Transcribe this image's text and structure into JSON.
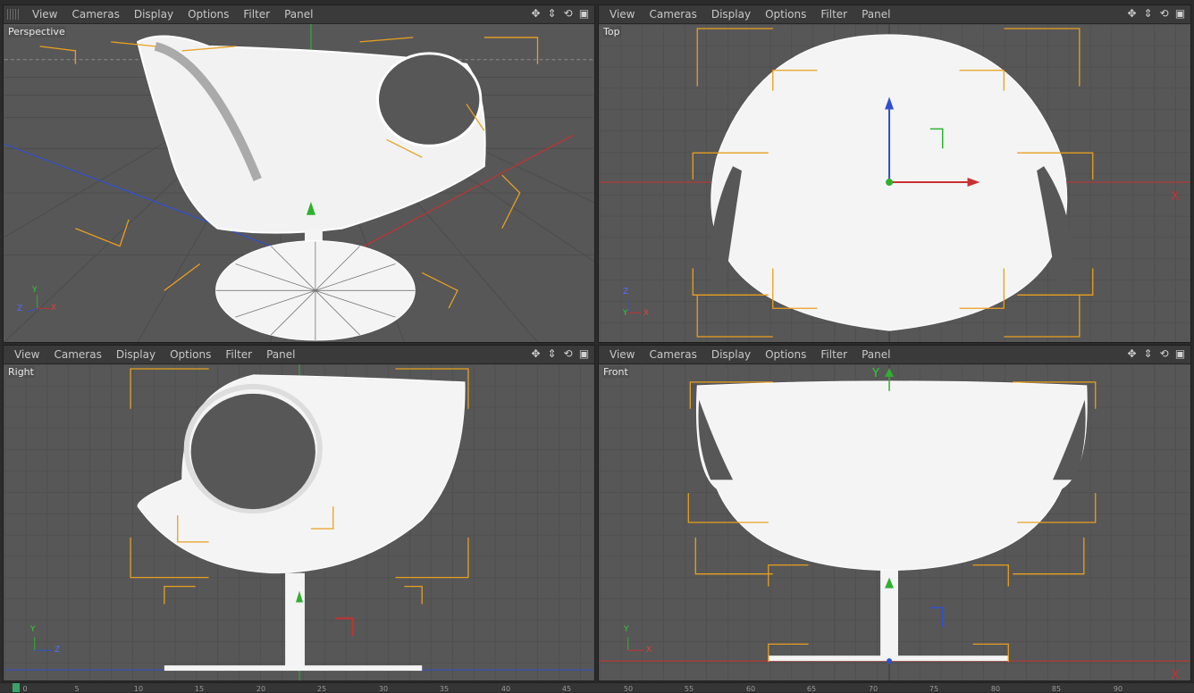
{
  "menu": [
    "View",
    "Cameras",
    "Display",
    "Options",
    "Filter",
    "Panel"
  ],
  "viewports": {
    "perspective": {
      "label": "Perspective"
    },
    "top": {
      "label": "Top"
    },
    "right": {
      "label": "Right"
    },
    "front": {
      "label": "Front"
    }
  },
  "axes": {
    "x": "X",
    "y": "Y",
    "z": "Z"
  },
  "tools": {
    "move": "✥",
    "pan": "⇕",
    "rotate": "⟲",
    "maximize": "▣"
  },
  "timeline": {
    "ticks": [
      "0",
      "5",
      "10",
      "15",
      "20",
      "25",
      "30",
      "35",
      "40",
      "45",
      "50",
      "55",
      "60",
      "65",
      "70",
      "75",
      "80",
      "85",
      "90"
    ]
  },
  "colors": {
    "viewport_bg": "#555555",
    "grid": "#4a4a4a",
    "wire": "#ffffff",
    "bbox": "#e8a020",
    "x_axis": "#c83030",
    "y_axis": "#2fb02f",
    "z_axis": "#3050d0"
  }
}
